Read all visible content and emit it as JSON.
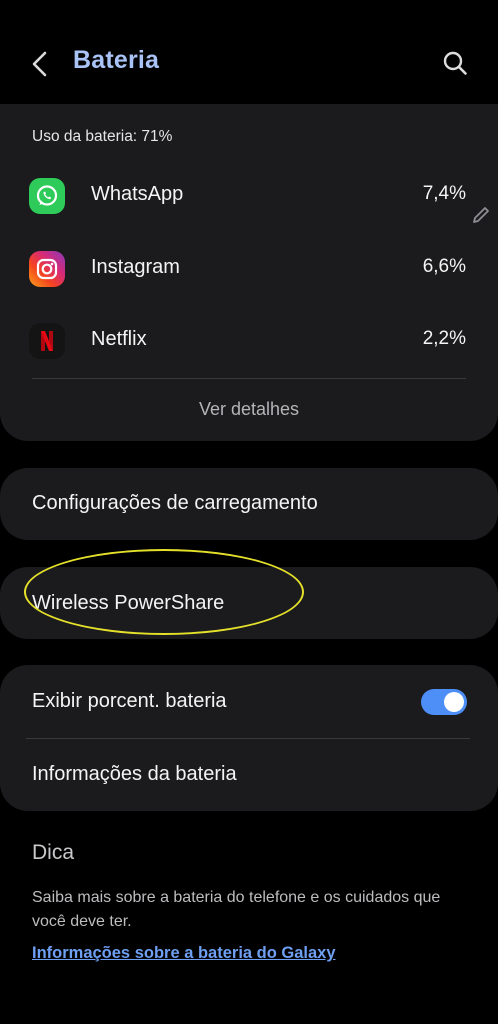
{
  "header": {
    "title": "Bateria"
  },
  "usage": {
    "label": "Uso da bateria: 71%",
    "apps": [
      {
        "name": "WhatsApp",
        "percent": "7,4%",
        "icon": "whatsapp-icon",
        "color": "#2ecb5a"
      },
      {
        "name": "Instagram",
        "percent": "6,6%",
        "icon": "instagram-icon",
        "color": "#d62a7a"
      },
      {
        "name": "Netflix",
        "percent": "2,2%",
        "icon": "netflix-icon",
        "color": "#e50914"
      }
    ],
    "details_label": "Ver detalhes"
  },
  "settings": {
    "charging": "Configurações de carregamento",
    "powershare": "Wireless PowerShare",
    "show_percent": "Exibir porcent. bateria",
    "show_percent_on": true,
    "battery_info": "Informações da bateria"
  },
  "tip": {
    "title": "Dica",
    "text": "Saiba mais sobre a bateria do telefone e os cuidados que você deve ter.",
    "link": "Informações sobre a bateria do Galaxy"
  },
  "colors": {
    "accent": "#a9c3f6",
    "toggle_on": "#4d8ef7",
    "highlight": "#e5e12b",
    "link": "#6e9ff2"
  }
}
